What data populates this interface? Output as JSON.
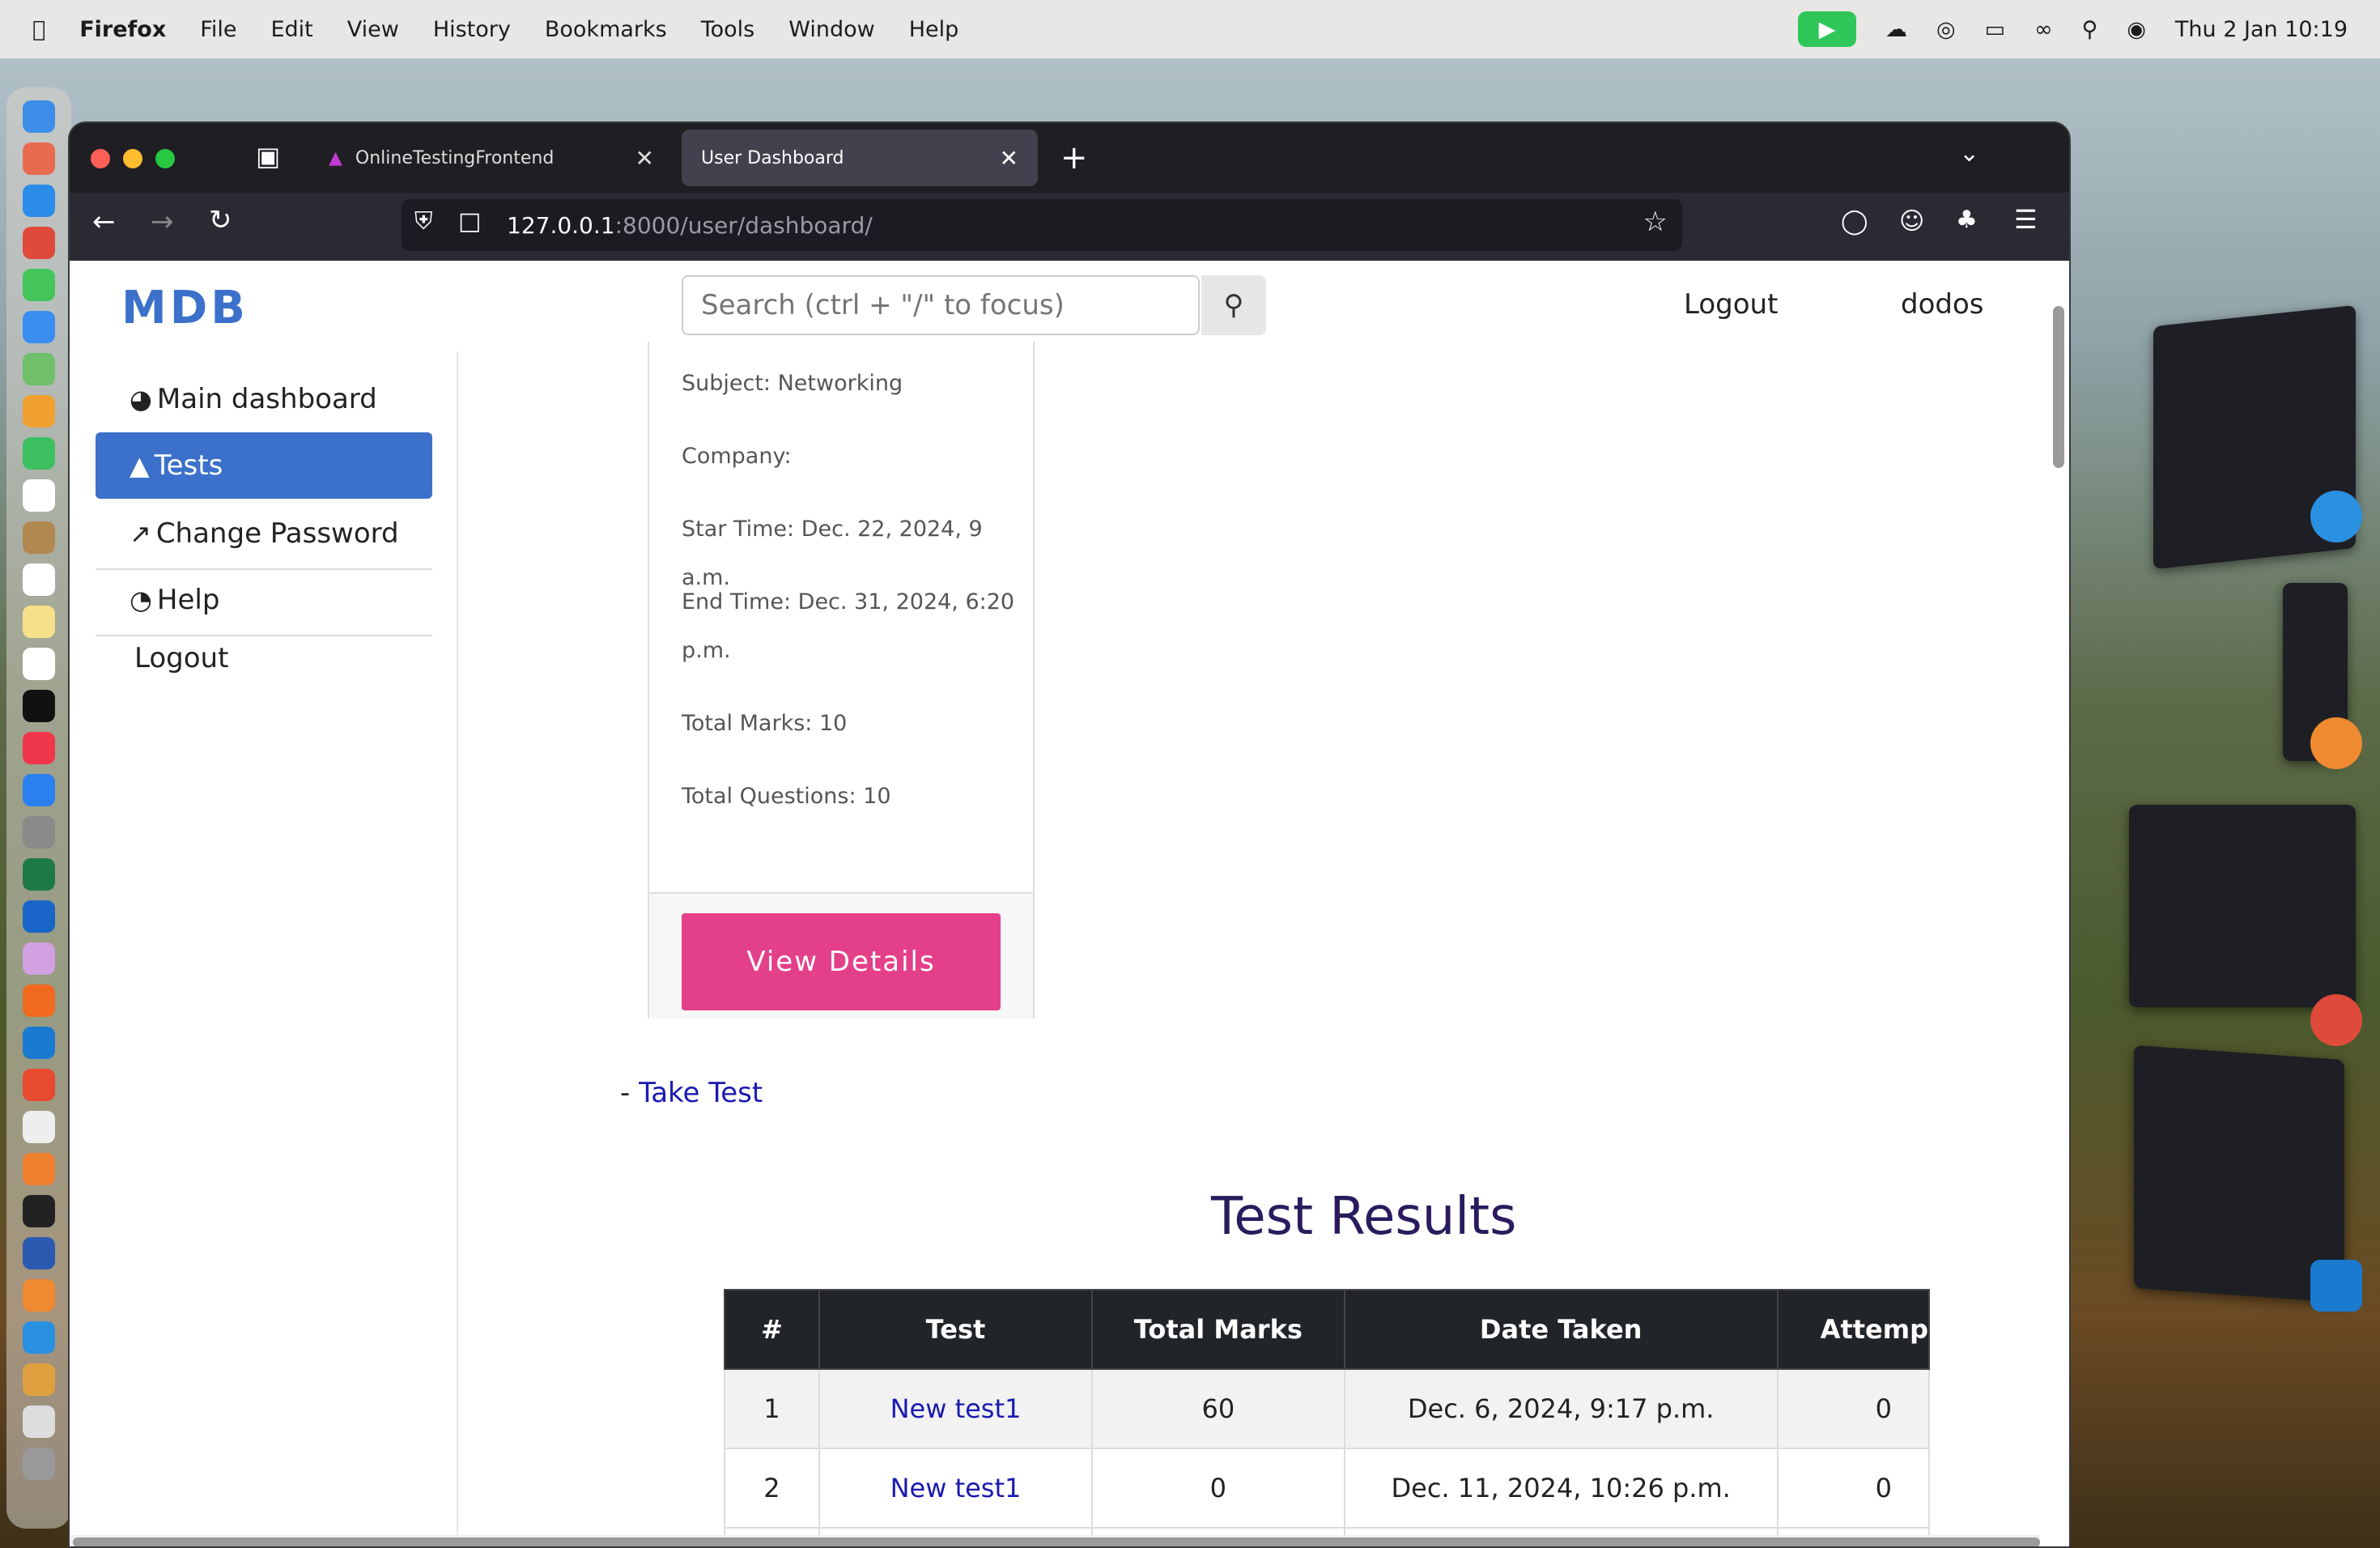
{
  "menubar": {
    "app": "Firefox",
    "items": [
      "File",
      "Edit",
      "View",
      "History",
      "Bookmarks",
      "Tools",
      "Window",
      "Help"
    ],
    "clock": "Thu 2 Jan  10:19"
  },
  "browser": {
    "tabs": [
      {
        "label": "OnlineTestingFrontend",
        "active": false
      },
      {
        "label": "User Dashboard",
        "active": true
      }
    ],
    "url_host": "127.0.0.1",
    "url_path": ":8000/user/dashboard/"
  },
  "navbar": {
    "logo": "MDB",
    "search_placeholder": "Search (ctrl + \"/\" to focus)",
    "links": [
      "Logout",
      "dodos"
    ]
  },
  "sidebar": {
    "items": [
      {
        "label": "Main dashboard",
        "icon": "gauge-icon",
        "active": false
      },
      {
        "label": "Tests",
        "icon": "chart-area-icon",
        "active": true
      },
      {
        "label": "Change Password",
        "icon": "chart-line-icon",
        "active": false
      },
      {
        "label": "Help",
        "icon": "chart-pie-icon",
        "active": false
      },
      {
        "label": "Logout",
        "icon": "",
        "active": false
      }
    ]
  },
  "card": {
    "subject": "Subject: Networking",
    "company": "Company:",
    "start": "Star Time: Dec. 22, 2024, 9 a.m.",
    "end_line1": "End Time: Dec. 31, 2024, 6:20",
    "end_line2": "p.m.",
    "marks": "Total Marks: 10",
    "questions": "Total Questions: 10",
    "button": "View Details"
  },
  "take_test": {
    "prefix": "- ",
    "link": "Take Test"
  },
  "results": {
    "title": "Test Results",
    "columns": [
      "#",
      "Test",
      "Total Marks",
      "Date Taken",
      "Attemp"
    ],
    "rows": [
      {
        "n": "1",
        "test": "New test1",
        "marks": "60",
        "date": "Dec. 6, 2024, 9:17 p.m.",
        "attempt": "0"
      },
      {
        "n": "2",
        "test": "New test1",
        "marks": "0",
        "date": "Dec. 11, 2024, 10:26 p.m.",
        "attempt": "0"
      }
    ]
  }
}
